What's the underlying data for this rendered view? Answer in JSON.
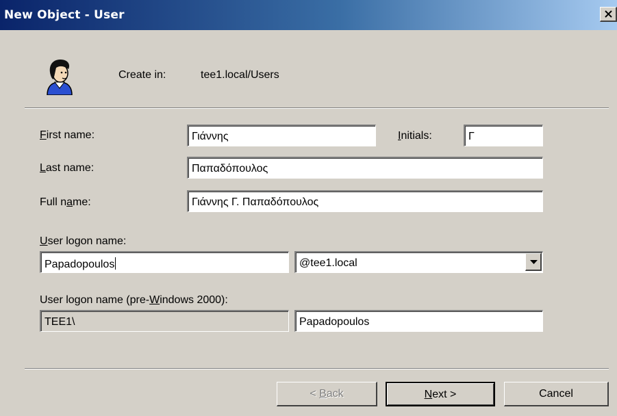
{
  "window": {
    "title": "New Object - User",
    "close_glyph": "×"
  },
  "header": {
    "icon": "user-icon",
    "create_in_label": "Create in:",
    "create_in_value": "tee1.local/Users"
  },
  "form": {
    "first_name": {
      "accesskey": "F",
      "label_rest": "irst name:",
      "value": "Γιάννης"
    },
    "initials": {
      "accesskey": "I",
      "label_rest": "nitials:",
      "value": "Γ"
    },
    "last_name": {
      "accesskey": "L",
      "label_rest": "ast name:",
      "value": "Παπαδόπουλος"
    },
    "full_name": {
      "label_pre": "Full n",
      "accesskey": "a",
      "label_post": "me:",
      "value": "Γιάννης Γ. Παπαδόπουλος"
    },
    "logon_name": {
      "accesskey": "U",
      "label_rest": "ser logon name:",
      "value": "Papadopoulos",
      "domain": "@tee1.local"
    },
    "pre2000": {
      "label_pre": "User logon name (pre-",
      "accesskey": "W",
      "label_post": "indows 2000):",
      "domain": "TEE1\\",
      "value": "Papadopoulos"
    }
  },
  "buttons": {
    "back": {
      "pre": "< ",
      "accesskey": "B",
      "post": "ack"
    },
    "next": {
      "accesskey": "N",
      "post": "ext >"
    },
    "cancel": "Cancel"
  }
}
